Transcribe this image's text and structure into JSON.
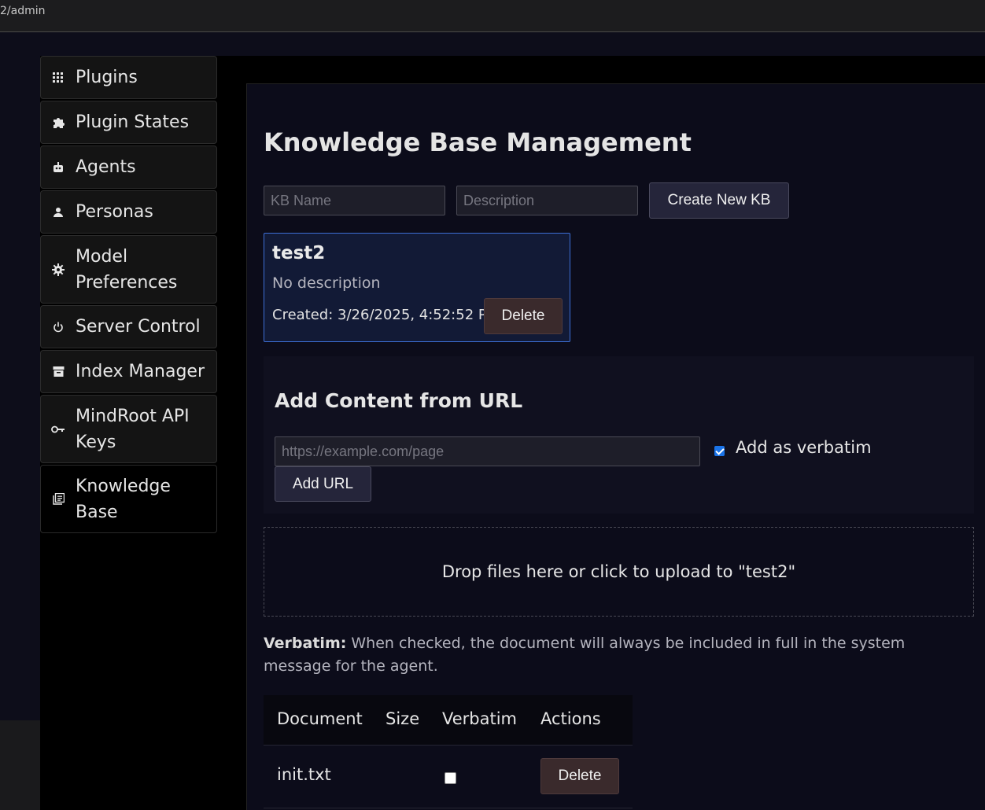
{
  "browser": {
    "url_fragment": "2/admin"
  },
  "sidebar": {
    "items": [
      {
        "label": "Plugins",
        "icon": "grid-icon"
      },
      {
        "label": "Plugin States",
        "icon": "puzzle-icon"
      },
      {
        "label": "Agents",
        "icon": "robot-icon"
      },
      {
        "label": "Personas",
        "icon": "person-icon"
      },
      {
        "label": "Model Preferences",
        "icon": "gear-icon"
      },
      {
        "label": "Server Control",
        "icon": "power-icon"
      },
      {
        "label": "Index Manager",
        "icon": "archive-icon"
      },
      {
        "label": "MindRoot API Keys",
        "icon": "key-icon"
      },
      {
        "label": "Knowledge Base",
        "icon": "library-icon"
      }
    ]
  },
  "main": {
    "title": "Knowledge Base Management",
    "kb_name_placeholder": "KB Name",
    "description_placeholder": "Description",
    "create_button": "Create New KB",
    "kb_card": {
      "name": "test2",
      "description": "No description",
      "created": "Created: 3/26/2025, 4:52:52 PM",
      "delete_button": "Delete"
    },
    "url_panel": {
      "title": "Add Content from URL",
      "url_placeholder": "https://example.com/page",
      "verbatim_label": "Add as verbatim",
      "verbatim_checked": true,
      "add_button": "Add URL"
    },
    "dropzone_text": "Drop files here or click to upload to \"test2\"",
    "verbatim_note_bold": "Verbatim:",
    "verbatim_note_text": " When checked, the document will always be included in full in the system message for the agent.",
    "table": {
      "headers": [
        "Document",
        "Size",
        "Verbatim",
        "Actions"
      ],
      "rows": [
        {
          "document": "init.txt",
          "size": "",
          "verbatim": false,
          "action": "Delete"
        }
      ]
    }
  }
}
